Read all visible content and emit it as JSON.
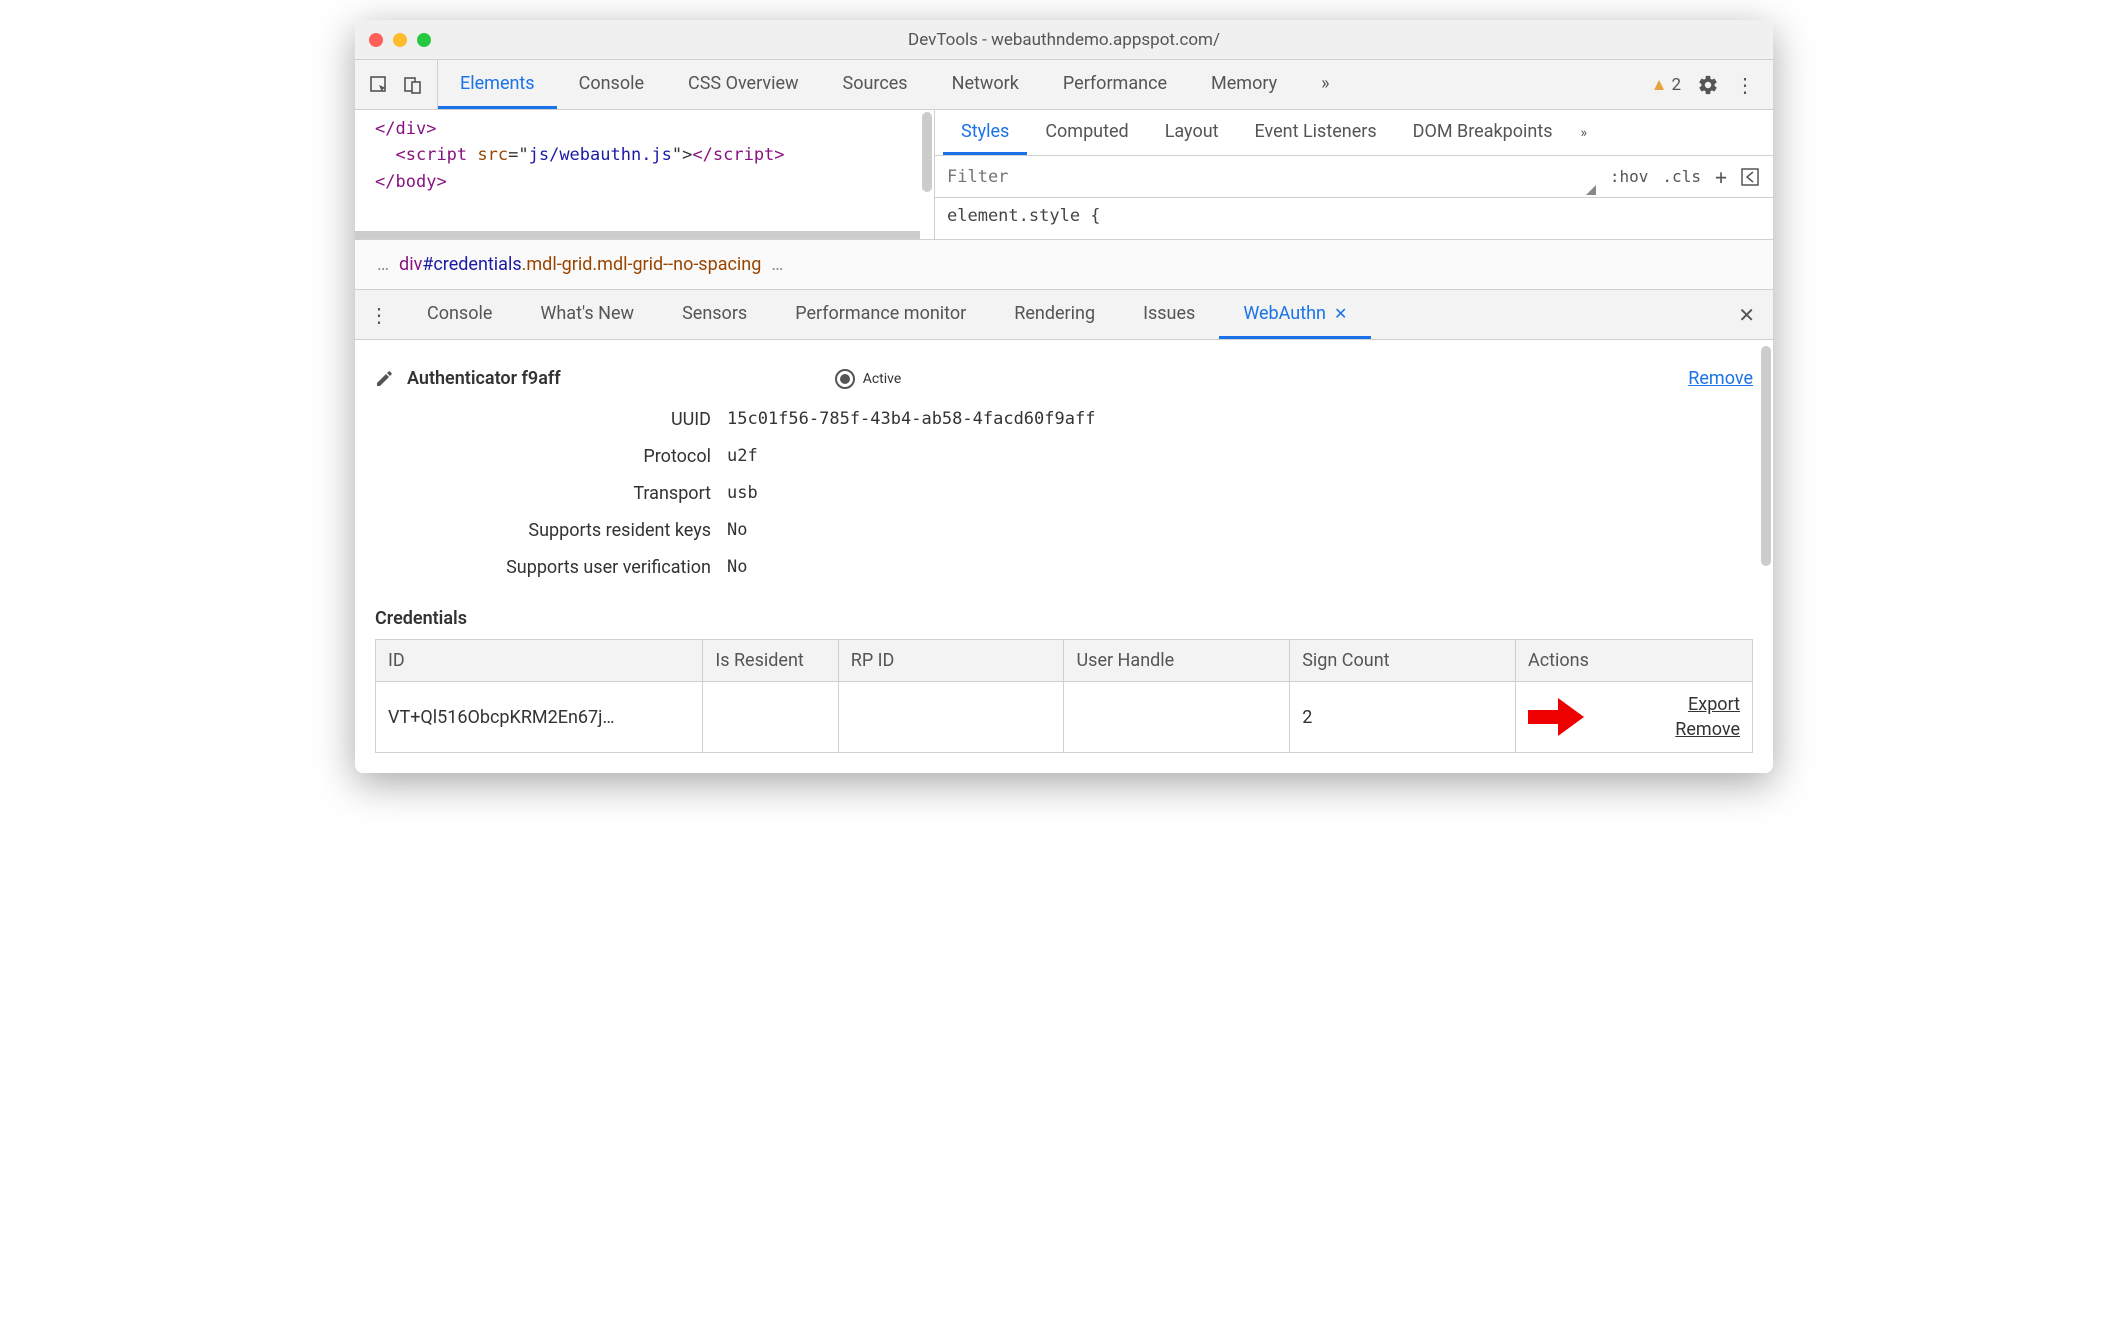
{
  "window": {
    "title": "DevTools - webauthndemo.appspot.com/"
  },
  "main_tabs": [
    "Elements",
    "Console",
    "CSS Overview",
    "Sources",
    "Network",
    "Performance",
    "Memory"
  ],
  "main_tabs_active": 0,
  "warning_count": "2",
  "code_lines": {
    "l1a": "</",
    "l1b": "div",
    "l1c": ">",
    "l2a": "<",
    "l2b": "script",
    "l2c": " ",
    "l2d": "src",
    "l2e": "=\"",
    "l2f": "js/webauthn.js",
    "l2g": "\">",
    "l2h": "</",
    "l2i": "script",
    "l2j": ">",
    "l3a": "</",
    "l3b": "body",
    "l3c": ">"
  },
  "styles_tabs": [
    "Styles",
    "Computed",
    "Layout",
    "Event Listeners",
    "DOM Breakpoints"
  ],
  "styles_tabs_active": 0,
  "filter_placeholder": "Filter",
  "filter_btns": {
    "hov": ":hov",
    "cls": ".cls"
  },
  "element_style": "element.style {",
  "breadcrumb": {
    "tag": "div",
    "id": "#credentials",
    "classes": ".mdl-grid.mdl-grid--no-spacing"
  },
  "drawer_tabs": [
    "Console",
    "What's New",
    "Sensors",
    "Performance monitor",
    "Rendering",
    "Issues",
    "WebAuthn"
  ],
  "drawer_tabs_active": 6,
  "authenticator": {
    "title": "Authenticator f9aff",
    "status_label": "Active",
    "remove_label": "Remove",
    "props": [
      {
        "label": "UUID",
        "value": "15c01f56-785f-43b4-ab58-4facd60f9aff"
      },
      {
        "label": "Protocol",
        "value": "u2f"
      },
      {
        "label": "Transport",
        "value": "usb"
      },
      {
        "label": "Supports resident keys",
        "value": "No"
      },
      {
        "label": "Supports user verification",
        "value": "No"
      }
    ]
  },
  "credentials": {
    "title": "Credentials",
    "headers": [
      "ID",
      "Is Resident",
      "RP ID",
      "User Handle",
      "Sign Count",
      "Actions"
    ],
    "row": {
      "id": "VT+Ql516ObcpKRM2En67j…",
      "is_resident": "",
      "rp_id": "",
      "user_handle": "",
      "sign_count": "2"
    },
    "actions": {
      "export": "Export",
      "remove": "Remove"
    }
  }
}
